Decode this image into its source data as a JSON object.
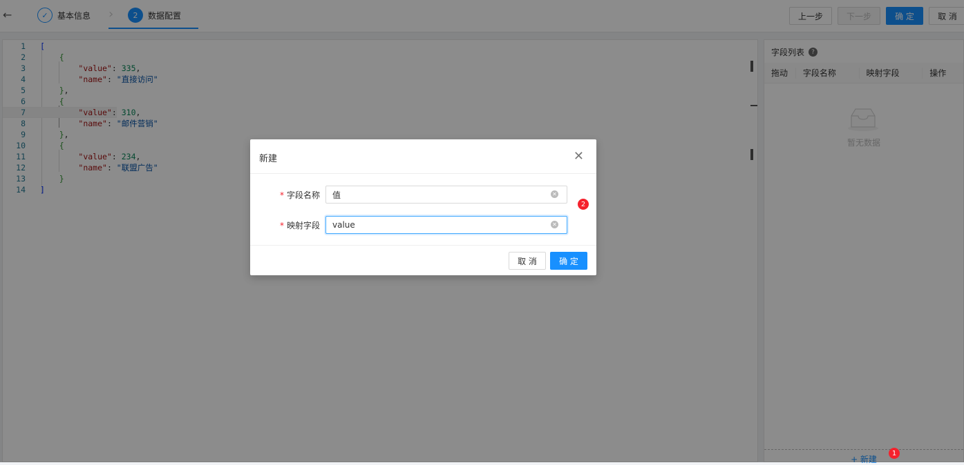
{
  "header": {
    "steps": [
      {
        "index": "✓",
        "label": "基本信息"
      },
      {
        "index": "2",
        "label": "数据配置"
      }
    ],
    "buttons": {
      "prev": "上一步",
      "next": "下一步",
      "confirm": "确 定",
      "cancel": "取 消"
    }
  },
  "editor": {
    "lines": [
      {
        "n": "1"
      },
      {
        "n": "2"
      },
      {
        "n": "3",
        "key": "\"value\"",
        "val": "335"
      },
      {
        "n": "4",
        "key": "\"name\"",
        "str": "\"直接访问\""
      },
      {
        "n": "5"
      },
      {
        "n": "6"
      },
      {
        "n": "7",
        "key": "\"value\"",
        "val": "310"
      },
      {
        "n": "8",
        "key": "\"name\"",
        "str": "\"邮件营销\""
      },
      {
        "n": "9"
      },
      {
        "n": "10"
      },
      {
        "n": "11",
        "key": "\"value\"",
        "val": "234"
      },
      {
        "n": "12",
        "key": "\"name\"",
        "str": "\"联盟广告\""
      },
      {
        "n": "13"
      },
      {
        "n": "14"
      }
    ]
  },
  "panel": {
    "title": "字段列表",
    "help": "?",
    "columns": [
      "拖动",
      "字段名称",
      "映射字段",
      "操作"
    ],
    "empty": "暂无数据",
    "add": "+ 新建",
    "badge": "1"
  },
  "dialog": {
    "title": "新建",
    "close": "✕",
    "badge": "2",
    "fields": [
      {
        "label": "字段名称",
        "value": "值"
      },
      {
        "label": "映射字段",
        "value": "value"
      }
    ],
    "cancel": "取 消",
    "ok": "确 定"
  }
}
